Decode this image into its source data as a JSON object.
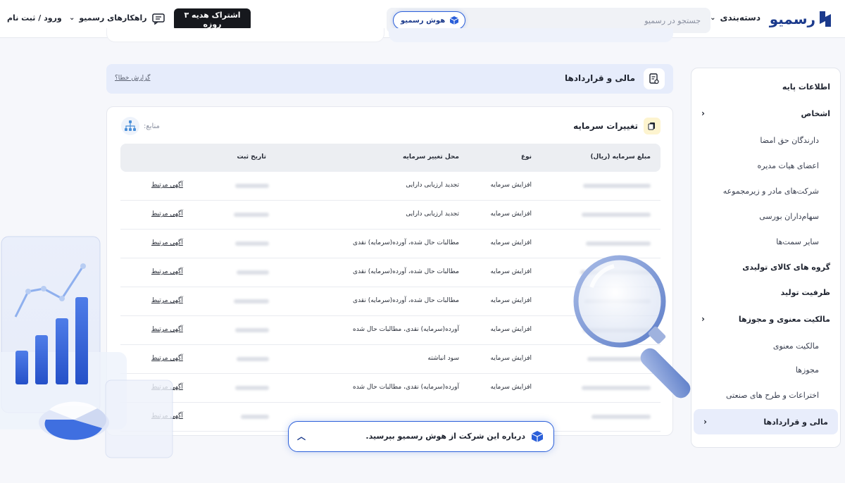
{
  "header": {
    "logo_text": "رسمیو",
    "category_label": "دسته‌بندی",
    "search_placeholder": "جستجو در رسمیو",
    "ai_pill_label": "هوش رسمیو",
    "gift_button": "اشتراک هدیه ۳ روزه",
    "solutions_label": "راهکارهای رسمیو",
    "login_label": "ورود / ثبت نام"
  },
  "sidebar": {
    "items": [
      {
        "label": "اطلاعات پایه",
        "kind": "head",
        "chevron": false
      },
      {
        "label": "اشخاص",
        "kind": "head",
        "chevron": true
      },
      {
        "label": "دارندگان حق امضا",
        "kind": "sub",
        "chevron": false
      },
      {
        "label": "اعضای هیات مدیره",
        "kind": "sub",
        "chevron": false
      },
      {
        "label": "شرکت‌های مادر و زیرمجموعه",
        "kind": "sub",
        "chevron": false
      },
      {
        "label": "سهام‌داران بورسی",
        "kind": "sub",
        "chevron": false
      },
      {
        "label": "سایر سمت‌ها",
        "kind": "sub",
        "chevron": false
      },
      {
        "label": "گروه های کالای تولیدی",
        "kind": "head",
        "chevron": false
      },
      {
        "label": "ظرفیت تولید",
        "kind": "head",
        "chevron": false
      },
      {
        "label": "مالکیت معنوی و مجوزها",
        "kind": "head",
        "chevron": true
      },
      {
        "label": "مالکیت معنوی",
        "kind": "sub",
        "chevron": false
      },
      {
        "label": "مجوزها",
        "kind": "sub",
        "chevron": false
      },
      {
        "label": "اختراعات و طرح های صنعتی",
        "kind": "sub",
        "chevron": false
      },
      {
        "label": "مالی و قراردادها",
        "kind": "active",
        "chevron": true
      }
    ]
  },
  "banner": {
    "title": "مالی و قراردادها",
    "report_link": "گزارش خطا؟"
  },
  "card": {
    "title": "تغییرات سرمایه",
    "sources_label": "منابع:",
    "columns": [
      "مبلغ سرمایه (ریال)",
      "نوع",
      "محل تغییر سرمایه",
      "تاریخ ثبت"
    ],
    "rows": [
      {
        "type": "افزایش سرمایه",
        "place": "تجدید ارزیابی دارایی",
        "link": "آگهی مرتبط"
      },
      {
        "type": "افزایش سرمایه",
        "place": "تجدید ارزیابی دارایی",
        "link": "آگهی مرتبط"
      },
      {
        "type": "افزایش سرمایه",
        "place": "مطالبات حال شده، آورده(سرمایه) نقدی",
        "link": "آگهی مرتبط"
      },
      {
        "type": "افزایش سرمایه",
        "place": "مطالبات حال شده، آورده(سرمایه) نقدی",
        "link": "آگهی مرتبط"
      },
      {
        "type": "افزایش سرمایه",
        "place": "مطالبات حال شده، آورده(سرمایه) نقدی",
        "link": "آگهی مرتبط"
      },
      {
        "type": "افزایش سرمایه",
        "place": "آورده(سرمایه) نقدی، مطالبات حال شده",
        "link": "آگهی مرتبط"
      },
      {
        "type": "افزایش سرمایه",
        "place": "سود انباشته",
        "link": "آگهی مرتبط"
      },
      {
        "type": "افزایش سرمایه",
        "place": "آورده(سرمایه) نقدی، مطالبات حال شده",
        "link": "آگهی مرتبط"
      },
      {
        "type": "",
        "place": "",
        "link": "آگهی مرتبط"
      }
    ]
  },
  "ai_bar": {
    "text": "درباره این شرکت از هوش رسمیو بپرسید."
  },
  "colors": {
    "accent": "#2b5fd9",
    "brand_dark": "#1b3a8c",
    "banner_bg": "#e6ecfb",
    "gift_bg": "#16181d"
  }
}
